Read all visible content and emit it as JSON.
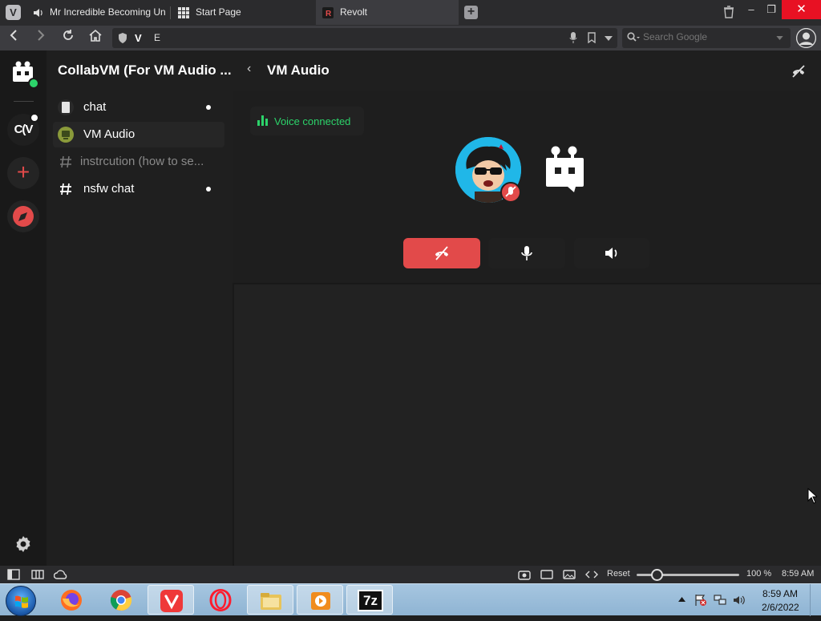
{
  "browser": {
    "tabs": [
      {
        "title": "Mr Incredible Becoming Un",
        "icon": "speaker-icon",
        "active": false
      },
      {
        "title": "Start Page",
        "icon": "grid-icon",
        "active": false
      },
      {
        "title": "Revolt",
        "icon": "revolt-icon",
        "active": true
      }
    ],
    "url": "E",
    "search_placeholder": "Search Google",
    "window_controls": {
      "minimize": "–",
      "restore": "❐",
      "close": "✕"
    }
  },
  "revolt": {
    "server_name": "CollabVM (For VM Audio ...",
    "server_rail": {
      "cv_label": "C(V",
      "add_label": "+"
    },
    "channels": [
      {
        "name": "chat",
        "type": "text-image",
        "unread": true
      },
      {
        "name": "VM Audio",
        "type": "voice-image",
        "unread": false,
        "selected": true
      },
      {
        "name": "instrcution (how to se...",
        "type": "text",
        "unread": false,
        "muted": true
      },
      {
        "name": "nsfw chat",
        "type": "text",
        "unread": true
      }
    ],
    "header": {
      "title": "VM Audio"
    },
    "voice": {
      "status": "Voice connected",
      "status_color": "#2cd36a"
    },
    "accent_color": "#e24a4a"
  },
  "statusbar": {
    "reset_label": "Reset",
    "zoom": "100 %",
    "time": "8:59 AM"
  },
  "taskbar": {
    "apps": [
      "firefox-icon",
      "chrome-icon",
      "vivaldi-icon",
      "opera-icon",
      "file-explorer-icon",
      "media-player-icon",
      "7zip-icon"
    ],
    "seven_zip_label": "7z",
    "clock_time": "8:59 AM",
    "clock_date": "2/6/2022"
  }
}
